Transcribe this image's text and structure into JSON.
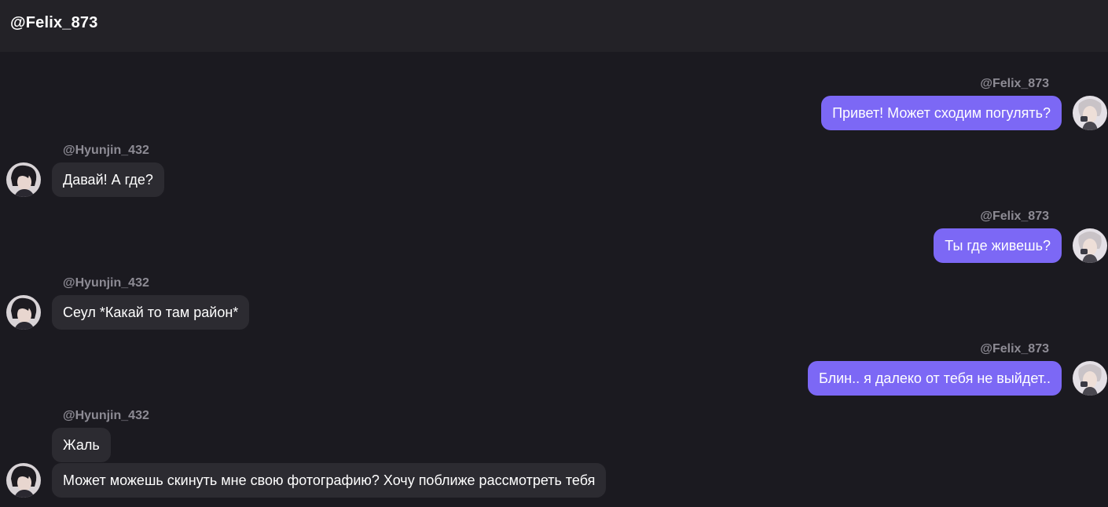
{
  "header": {
    "title": "@Felix_873"
  },
  "messages": [
    {
      "sender": "@Felix_873",
      "side": "out",
      "text": "Привет! Может сходим погулять?"
    },
    {
      "sender": "@Hyunjin_432",
      "side": "in",
      "text": "Давай! А где?"
    },
    {
      "sender": "@Felix_873",
      "side": "out",
      "text": "Ты где живешь?"
    },
    {
      "sender": "@Hyunjin_432",
      "side": "in",
      "text": "Сеул *Какай то там район*"
    },
    {
      "sender": "@Felix_873",
      "side": "out",
      "text": "Блин.. я далеко от тебя не выйдет.."
    },
    {
      "sender": "@Hyunjin_432",
      "side": "in",
      "text": "Жаль"
    },
    {
      "sender": "@Hyunjin_432",
      "side": "in",
      "text": "Может можешь скинуть мне свою фотографию? Хочу поближе рассмотреть тебя"
    }
  ],
  "colors": {
    "background": "#1b1a20",
    "header": "#232227",
    "incoming_bubble": "#2c2b31",
    "outgoing_bubble": "#7c68f5",
    "username": "#8d8b94"
  },
  "icons": {
    "incoming_avatar": "user-avatar-icon",
    "outgoing_avatar": "user-avatar-icon"
  }
}
